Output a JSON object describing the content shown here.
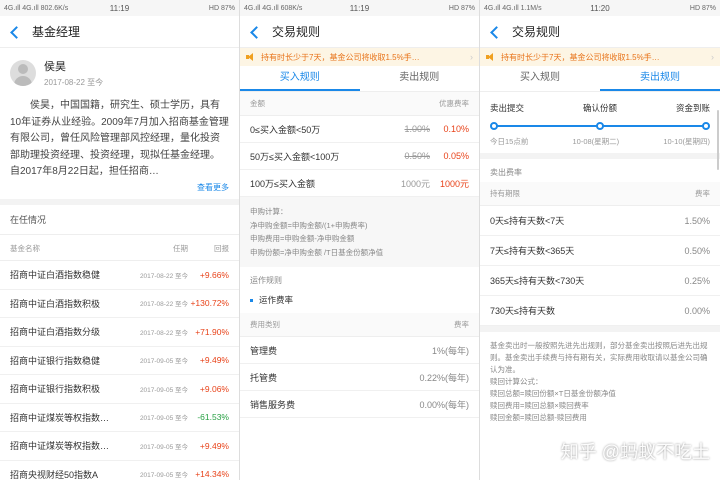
{
  "screen1": {
    "status": {
      "left": "4G.ıll 4G.ıll 802.6K/s",
      "time": "11:19",
      "right": "HD 87%"
    },
    "title": "基金经理",
    "manager": {
      "name": "侯昊",
      "date": "2017-08-22 至今"
    },
    "bio": "侯昊，中国国籍，研究生、硕士学历，具有10年证券从业经验。2009年7月加入招商基金管理有限公司，曾任风险管理部风控经理，量化投资部助理投资经理、投资经理，现拟任基金经理。自2017年8月22日起，担任招商…",
    "more": "查看更多",
    "section": "在任情况",
    "headers": {
      "name": "基金名称",
      "term": "任期",
      "ret": "回报"
    },
    "funds": [
      {
        "name": "招商中证白酒指数稳健",
        "term": "2017-08-22 至今",
        "ret": "+9.66%"
      },
      {
        "name": "招商中证白酒指数积极",
        "term": "2017-08-22 至今",
        "ret": "+130.72%"
      },
      {
        "name": "招商中证白酒指数分级",
        "term": "2017-08-22 至今",
        "ret": "+71.90%"
      },
      {
        "name": "招商中证银行指数稳健",
        "term": "2017-09-05 至今",
        "ret": "+9.49%"
      },
      {
        "name": "招商中证银行指数积极",
        "term": "2017-09-05 至今",
        "ret": "+9.06%"
      },
      {
        "name": "招商中证煤炭等权指数…",
        "term": "2017-09-05 至今",
        "ret": "-61.53%"
      },
      {
        "name": "招商中证煤炭等权指数…",
        "term": "2017-09-05 至今",
        "ret": "+9.49%"
      },
      {
        "name": "招商央视财经50指数A",
        "term": "2017-09-05 至今",
        "ret": "+14.34%"
      }
    ]
  },
  "screen2": {
    "status": {
      "left": "4G.ıll 4G.ıll 608K/s",
      "time": "11:19",
      "right": "HD 87%"
    },
    "title": "交易规则",
    "notice": "持有时长少于7天，基金公司将收取1.5%手…",
    "tabs": [
      "买入规则",
      "卖出规则"
    ],
    "headers": {
      "amount": "金额",
      "rate": "优惠费率"
    },
    "rows": [
      {
        "range": "0≤买入金额<50万",
        "orig": "1.00%",
        "disc": "0.10%"
      },
      {
        "range": "50万≤买入金额<100万",
        "orig": "0.50%",
        "disc": "0.05%"
      },
      {
        "range": "100万≤买入金额",
        "orig": "1000元",
        "disc": "1000元"
      }
    ],
    "formula": [
      "申购计算：",
      "净申购金额=申购金额/(1+申购费率)",
      "申购费用=申购金额-净申购金额",
      "申购份额=净申购金额 /T日基金份额净值"
    ],
    "ops_title": "运作规则",
    "ops_item": "运作费率",
    "fee_headers": {
      "type": "费用类别",
      "rate": "费率"
    },
    "fees": [
      {
        "type": "管理费",
        "rate": "1%(每年)"
      },
      {
        "type": "托管费",
        "rate": "0.22%(每年)"
      },
      {
        "type": "销售服务费",
        "rate": "0.00%(每年)"
      }
    ]
  },
  "screen3": {
    "status": {
      "left": "4G.ıll 4G.ıll 1.1M/s",
      "time": "11:20",
      "right": "HD 87%"
    },
    "title": "交易规则",
    "notice": "持有时长少于7天，基金公司将收取1.5%手…",
    "tabs": [
      "买入规则",
      "卖出规则"
    ],
    "timeline": {
      "labels": [
        "卖出提交",
        "确认份额",
        "资金到账"
      ],
      "dates": [
        "今日15点前",
        "10-08(星期二)",
        "10-10(星期四)"
      ]
    },
    "sell_title": "卖出费率",
    "headers": {
      "period": "持有期限",
      "rate": "费率"
    },
    "rows": [
      {
        "period": "0天≤持有天数<7天",
        "rate": "1.50%"
      },
      {
        "period": "7天≤持有天数<365天",
        "rate": "0.50%"
      },
      {
        "period": "365天≤持有天数<730天",
        "rate": "0.25%"
      },
      {
        "period": "730天≤持有天数",
        "rate": "0.00%"
      }
    ],
    "rules": [
      "基金卖出时一般按照先进先出规则，部分基金卖出按照后进先出规则。基金卖出手续费与持有期有关，实际费用收取请以基金公司确认为准。",
      "赎回计算公式：",
      "赎回总额=赎回份额×T日基金份额净值",
      "赎回费用=赎回总额×赎回费率",
      "赎回金额=赎回总额-赎回费用"
    ],
    "watermark": "知乎 @蚂蚁不吃土"
  }
}
